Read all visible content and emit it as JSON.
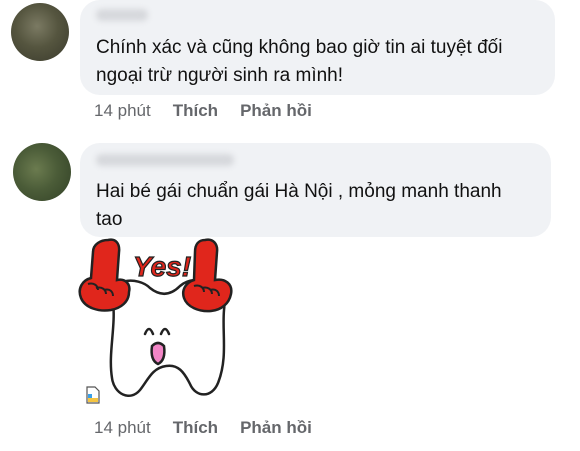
{
  "comments": [
    {
      "text": "Chính xác và cũng không bao giờ tin ai tuyệt đối\nngoại trừ người sinh ra mình!",
      "time": "14 phút",
      "like": "Thích",
      "reply": "Phản hồi"
    },
    {
      "text": "Hai bé gái chuẩn gái Hà Nội , mỏng manh thanh\ntao",
      "time": "14 phút",
      "like": "Thích",
      "reply": "Phản hồi",
      "sticker_text": "Yes!"
    }
  ],
  "icons": {
    "attachment": "file-icon"
  },
  "colors": {
    "bubble": "#f0f2f5",
    "meta": "#65676b",
    "sticker_red": "#e0261c"
  }
}
